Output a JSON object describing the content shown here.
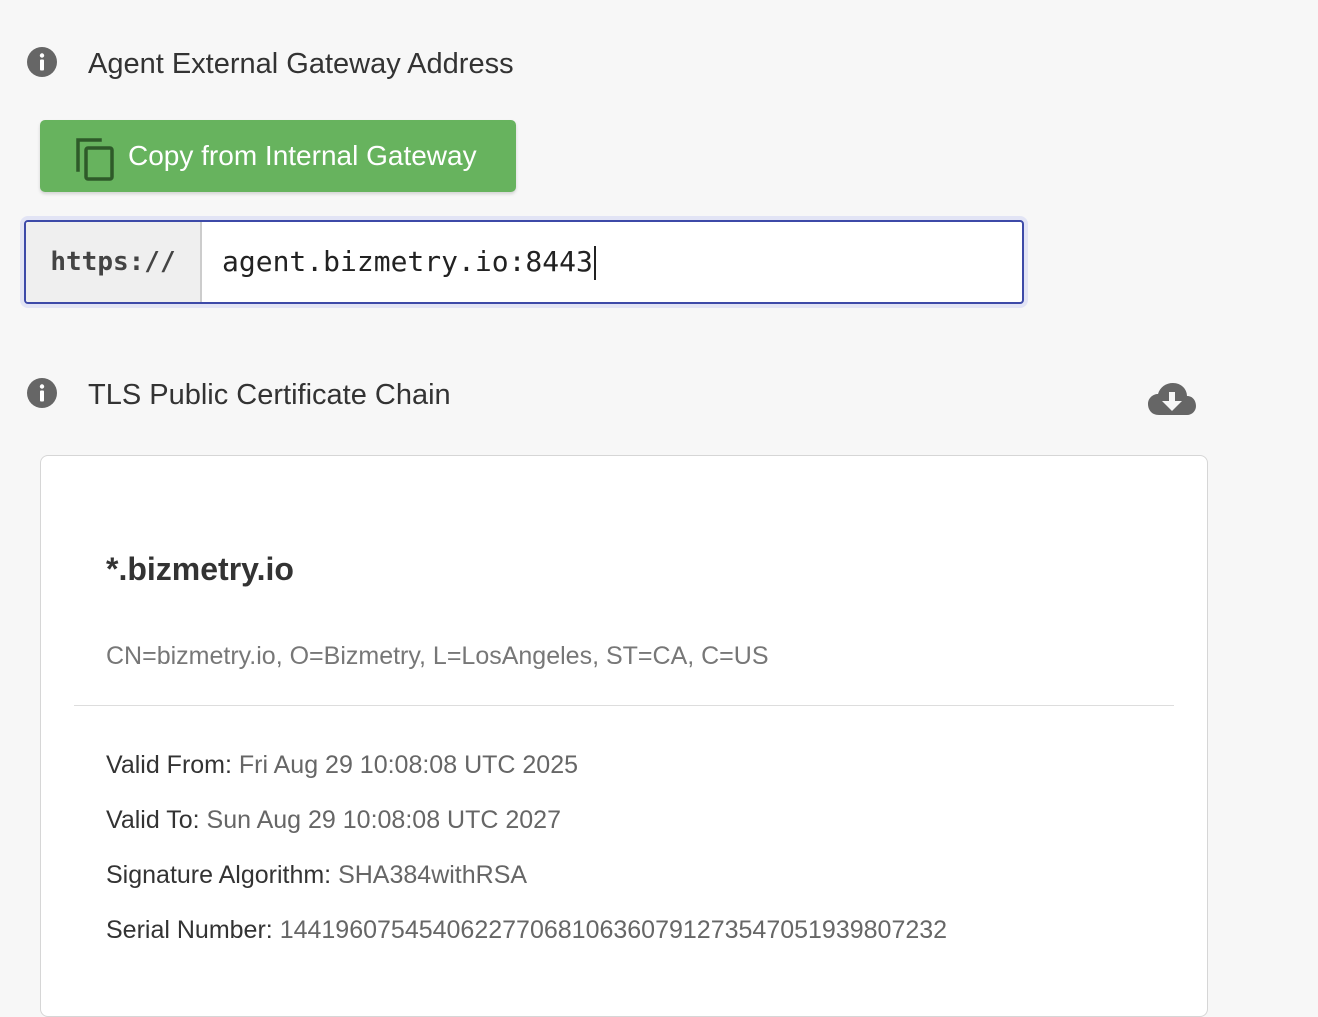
{
  "gateway": {
    "title": "Agent External Gateway Address",
    "copy_button_label": "Copy from Internal Gateway",
    "url_prefix": "https://",
    "url_value": "agent.bizmetry.io:8443"
  },
  "certificate_section": {
    "title": "TLS Public Certificate Chain",
    "download_icon": "cloud-download-icon",
    "info_icon": "info-icon"
  },
  "certificate": {
    "name": "*.bizmetry.io",
    "subject": "CN=bizmetry.io, O=Bizmetry, L=LosAngeles, ST=CA, C=US",
    "valid_from_label": "Valid From:",
    "valid_from": "Fri Aug 29 10:08:08 UTC 2025",
    "valid_to_label": "Valid To:",
    "valid_to": "Sun Aug 29 10:08:08 UTC 2027",
    "signature_algorithm_label": "Signature Algorithm:",
    "signature_algorithm": "SHA384withRSA",
    "serial_number_label": "Serial Number:",
    "serial_number": "144196075454062277068106360791273547051939807232"
  },
  "colors": {
    "primary_button": "#67b35e",
    "focus_border": "#3d4aa8",
    "icon_gray": "#666666"
  }
}
